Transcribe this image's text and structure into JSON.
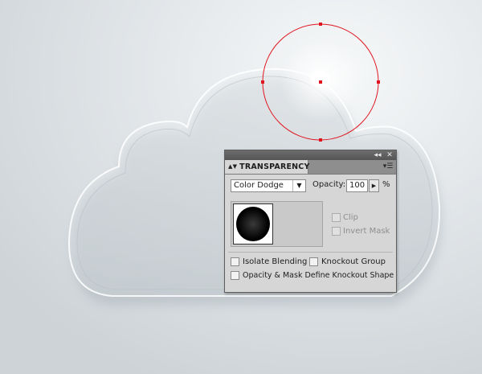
{
  "panel": {
    "title": "TRANSPARENCY",
    "collapse_icon": "double-left-arrow-icon",
    "close_icon": "close-icon",
    "menu_icon": "panel-menu-icon",
    "blend_mode": "Color Dodge",
    "opacity_label": "Opacity:",
    "opacity_value": "100",
    "opacity_unit": "%",
    "clip_label": "Clip",
    "invert_mask_label": "Invert Mask",
    "isolate_blending_label": "Isolate Blending",
    "knockout_group_label": "Knockout Group",
    "opacity_mask_label": "Opacity & Mask Define Knockout Shape"
  },
  "colors": {
    "selection": "#e0141e",
    "panel_bg": "#d6d6d6",
    "titlebar": "#5e5e5e"
  }
}
